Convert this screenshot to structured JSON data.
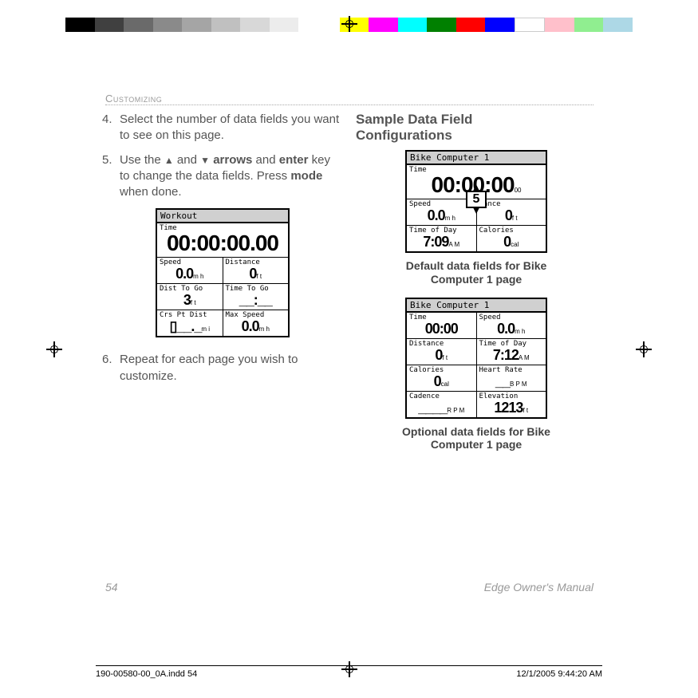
{
  "colorbar": [
    "#000000",
    "#404040",
    "#6a6a6a",
    "#8a8a8a",
    "#a5a5a5",
    "#c0c0c0",
    "#d8d8d8",
    "#ececec",
    "#ffffff",
    "",
    "#ffff00",
    "#ff00ff",
    "#00ffff",
    "#008000",
    "#ff0000",
    "#0000ff",
    "#ffffff",
    "#ffc0cb",
    "#90ee90",
    "#add8e6"
  ],
  "header": "Customizing",
  "left_col": {
    "steps": [
      {
        "n": "4.",
        "text_a": "Select the number of data fields you want to see on this page."
      },
      {
        "n": "5.",
        "text_a": "Use the ",
        "arrow": true,
        "text_b": " and ",
        "text_c": " arrows",
        "text_d": " and ",
        "text_e": "enter",
        "text_f": " key to change the data fields. Press ",
        "text_g": "mode",
        "text_h": " when done."
      },
      {
        "n": "6.",
        "text_a": "Repeat for each page you wish to customize."
      }
    ],
    "lcd": {
      "title": "Workout",
      "fields": {
        "time_l": "Time",
        "time_v": "00:00:00.00",
        "speed_l": "Speed",
        "speed_v": "0.0",
        "speed_u": "m h",
        "dist_l": "Distance",
        "dist_v": "0",
        "dist_u": "f t",
        "dtg_l": "Dist To Go",
        "dtg_v": "3",
        "dtg_u": "f t",
        "ttg_l": "Time To Go",
        "ttg_v": "__:__",
        "cpt_l": "Crs Pt Dist",
        "cpt_v": "__._",
        "cpt_u": "m i",
        "max_l": "Max Speed",
        "max_v": "0.0",
        "max_u": "m h"
      }
    }
  },
  "right_col": {
    "heading_l1": "Sample Data Field",
    "heading_l2": "Configurations",
    "lcd1": {
      "title": "Bike Computer 1",
      "selector_val": "5",
      "fields": {
        "time_l": "Time",
        "time_v": "00:00:00",
        "speed_l": "Speed",
        "speed_v": "0.0",
        "speed_u": "m h",
        "dist_l": "tance",
        "dist_v": "0",
        "dist_u": "f t",
        "tod_l": "Time of Day",
        "tod_v": "7:09",
        "tod_u": "A M",
        "cal_l": "Calories",
        "cal_v": "0",
        "cal_u": "cal"
      }
    },
    "caption1_l1": "Default data fields for Bike",
    "caption1_l2": "Computer 1 page",
    "lcd2": {
      "title": "Bike Computer 1",
      "fields": {
        "time_l": "Time",
        "time_v": "00:00",
        "speed_l": "Speed",
        "speed_v": "0.0",
        "speed_u": "m h",
        "dist_l": "Distance",
        "dist_v": "0",
        "dist_u": "f t",
        "tod_l": "Time of Day",
        "tod_v": "7:12",
        "tod_u": "A M",
        "cal_l": "Calories",
        "cal_v": "0",
        "cal_u": "cal",
        "hr_l": "Heart Rate",
        "hr_v": "__",
        "hr_u": "B P M",
        "cad_l": "Cadence",
        "cad_v": "____",
        "cad_u": "R P M",
        "elev_l": "Elevation",
        "elev_v": "1213",
        "elev_u": "f t"
      }
    },
    "caption2_l1": "Optional data fields for Bike",
    "caption2_l2": "Computer 1 page"
  },
  "footer": {
    "page": "54",
    "title": "Edge Owner's Manual"
  },
  "slug": {
    "file": "190-00580-00_0A.indd   54",
    "stamp": "12/1/2005   9:44:20 AM"
  }
}
